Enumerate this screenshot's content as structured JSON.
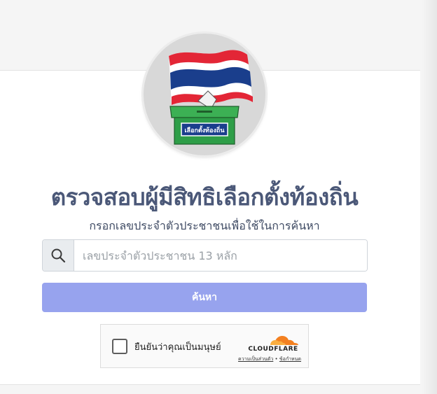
{
  "header": {
    "title": "ตรวจสอบผู้มีสิทธิเลือกตั้งท้องถิ่น",
    "subtitle": "กรอกเลขประจำตัวประชาชนเพื่อใช้ในการค้นหา"
  },
  "logo": {
    "ballot_label": "เลือกตั้งท้องถิ่น",
    "icon": "thai-flag-ballot-box-icon"
  },
  "search": {
    "placeholder": "เลขประจำตัวประชาชน 13 หลัก",
    "value": "",
    "icon": "search-icon",
    "button_label": "ค้นหา"
  },
  "captcha": {
    "label": "ยืนยันว่าคุณเป็นมนุษย์",
    "brand": "CLOUDFLARE",
    "privacy_link": "ความเป็นส่วนตัว",
    "separator": "•",
    "terms_link": "ข้อกำหนด"
  },
  "colors": {
    "title": "#4b5878",
    "button": "#97a3ee",
    "flag_red": "#e32636",
    "flag_blue": "#1a3e8c",
    "ballot_green": "#2e9e48",
    "cloudflare_orange": "#f38020"
  }
}
